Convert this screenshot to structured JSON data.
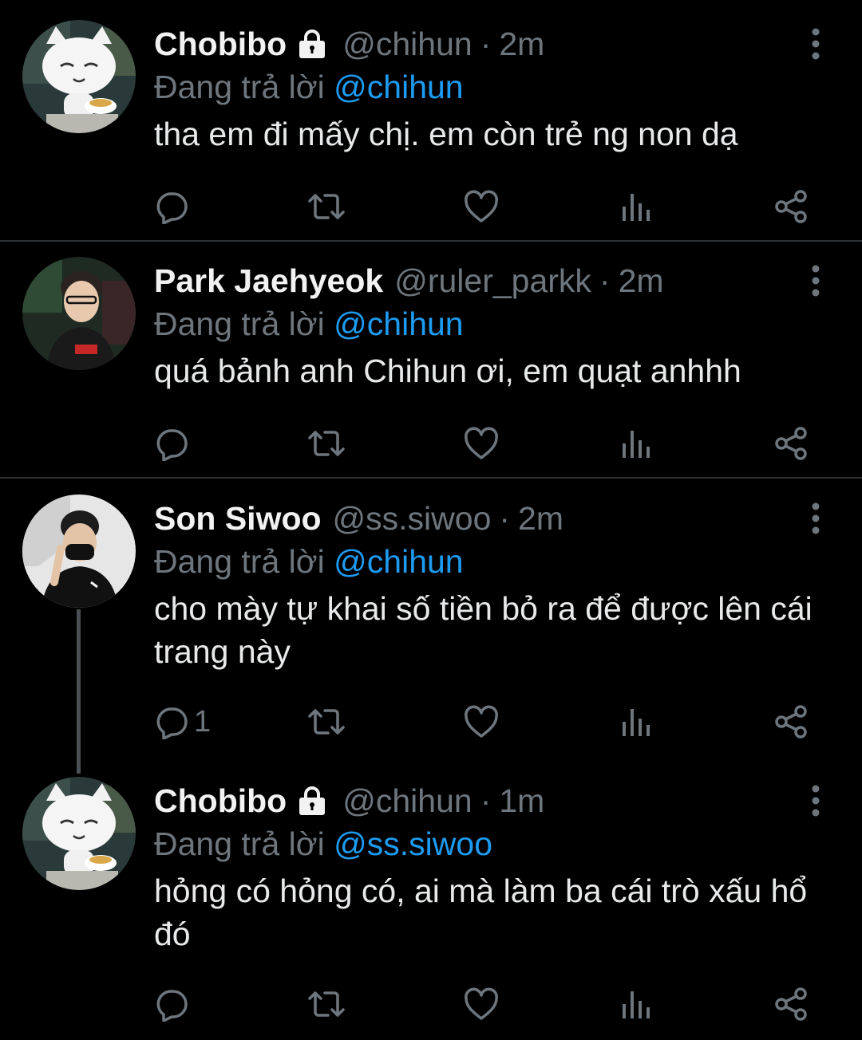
{
  "tweets": [
    {
      "name": "Chobibo",
      "protected": true,
      "handle": "@chihun",
      "separator": "·",
      "time": "2m",
      "replying_prefix": "Đang trả lời",
      "replying_to": "@chihun",
      "text": "tha em đi mấy chị. em còn trẻ ng non dạ",
      "reply_count": "",
      "avatar_icon": "cat-mascot-avatar"
    },
    {
      "name": "Park Jaehyeok",
      "protected": false,
      "handle": "@ruler_parkk",
      "separator": "·",
      "time": "2m",
      "replying_prefix": "Đang trả lời",
      "replying_to": "@chihun",
      "text": "quá bảnh anh Chihun ơi, em quạt anhhh",
      "reply_count": "",
      "avatar_icon": "person-photo-avatar"
    },
    {
      "name": "Son Siwoo",
      "protected": false,
      "handle": "@ss.siwoo",
      "separator": "·",
      "time": "2m",
      "replying_prefix": "Đang trả lời",
      "replying_to": "@chihun",
      "text": "cho mày tự khai số tiền bỏ ra để được lên cái trang này",
      "reply_count": "1",
      "avatar_icon": "person-photo-avatar"
    },
    {
      "name": "Chobibo",
      "protected": true,
      "handle": "@chihun",
      "separator": "·",
      "time": "1m",
      "replying_prefix": "Đang trả lời",
      "replying_to": "@ss.siwoo",
      "text": "hỏng có hỏng có, ai mà làm ba cái trò xấu hổ đó",
      "reply_count": "",
      "avatar_icon": "cat-mascot-avatar"
    }
  ],
  "colors": {
    "background": "#000000",
    "text": "#e7e9ea",
    "secondary": "#6e767d",
    "mention": "#1d9bf0",
    "divider": "#2f3336"
  },
  "icons": [
    "reply-icon",
    "retweet-icon",
    "like-icon",
    "analytics-icon",
    "share-icon",
    "more-icon",
    "lock-icon"
  ]
}
